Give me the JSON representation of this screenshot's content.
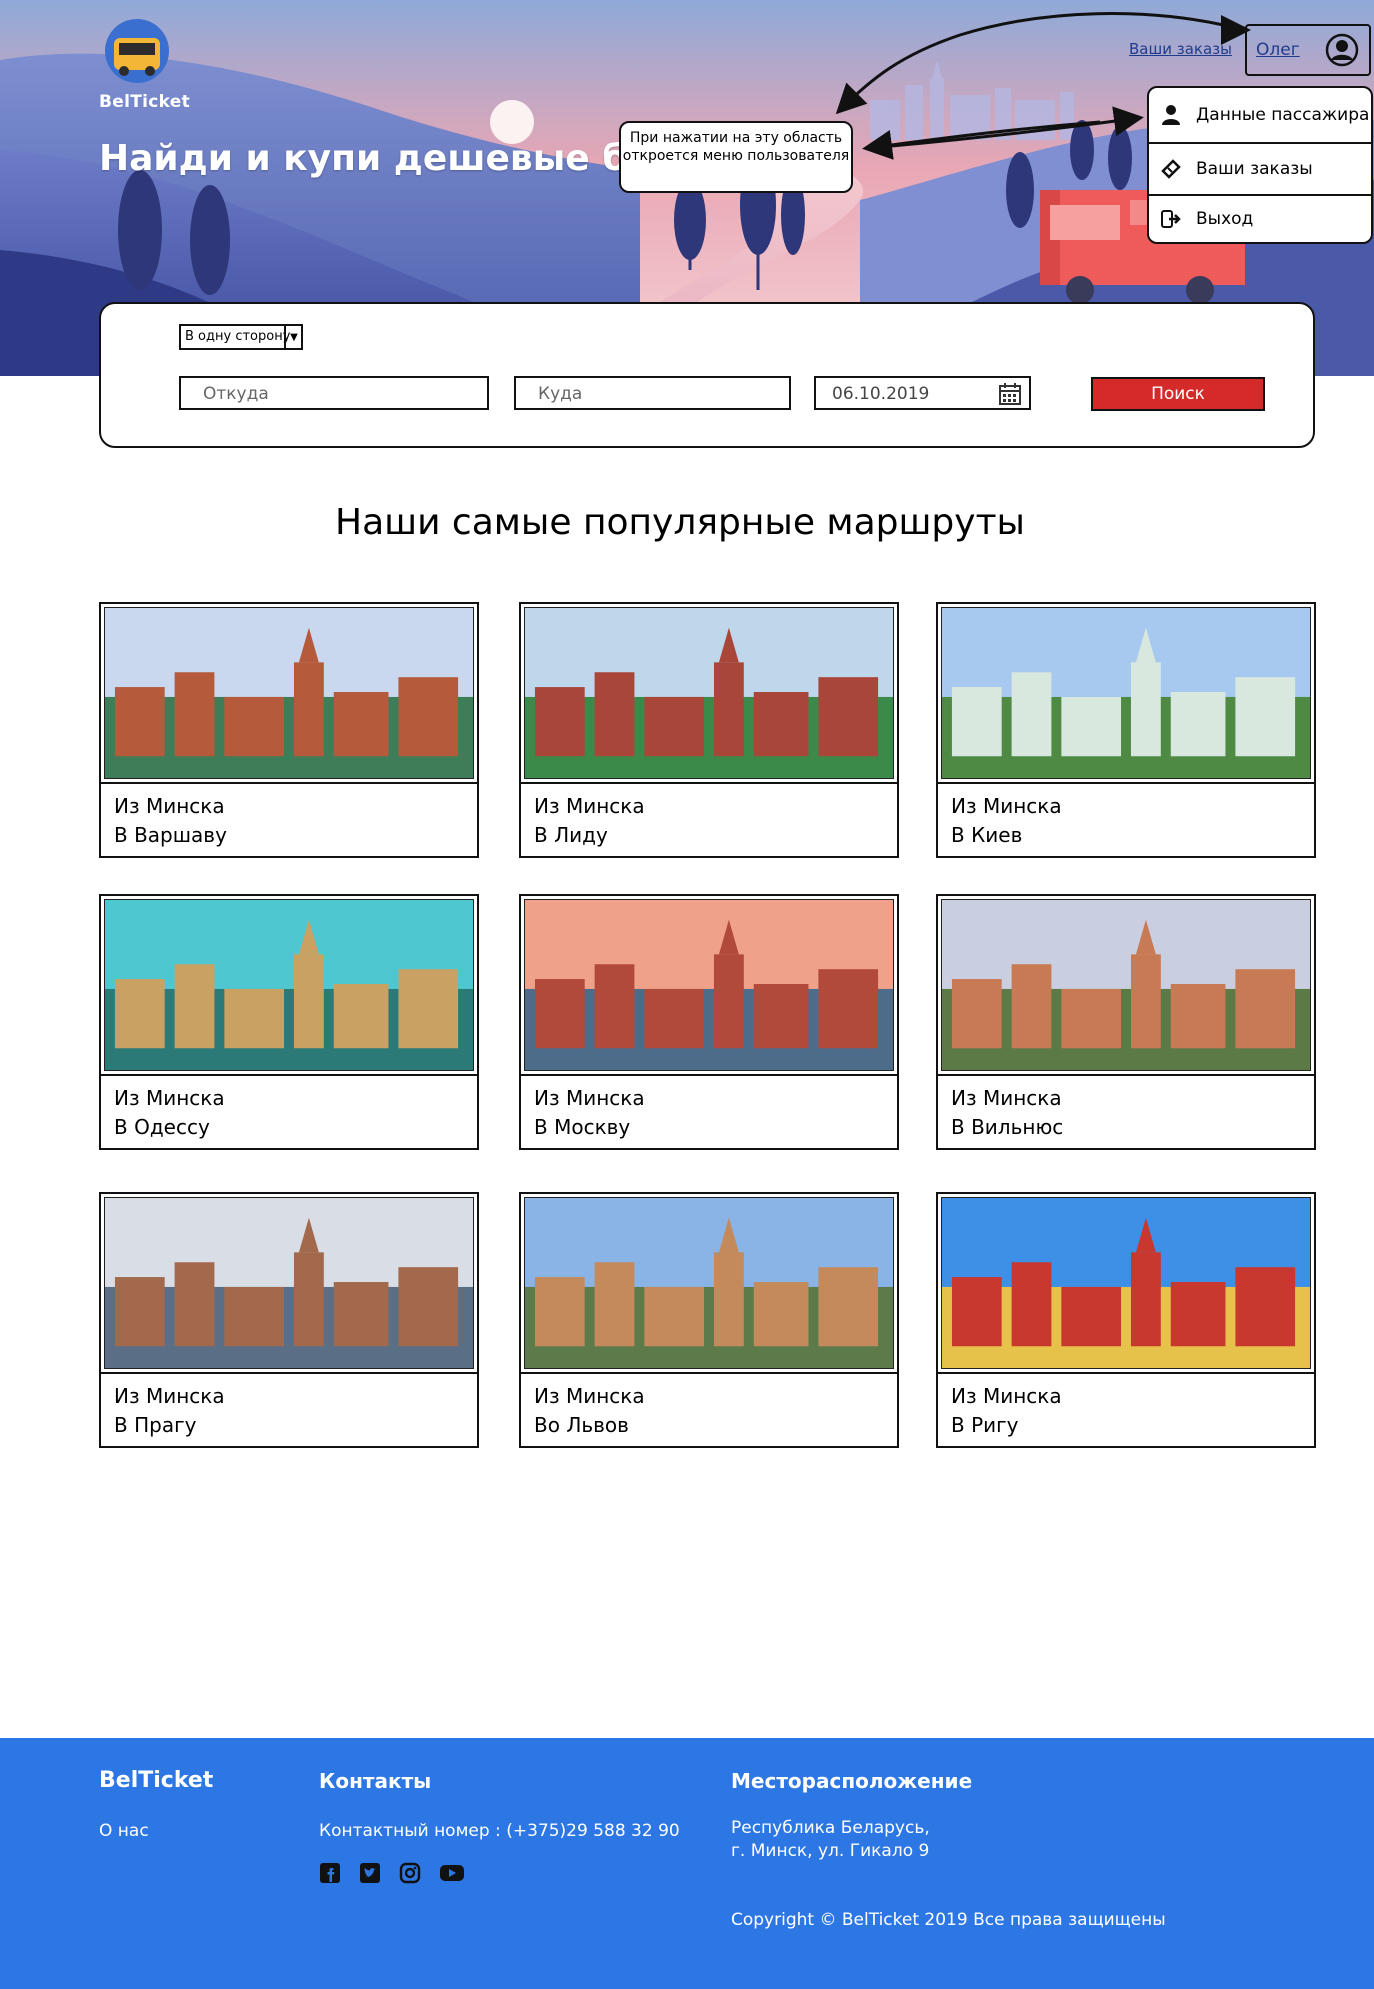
{
  "header": {
    "brand": "BelTicket",
    "title": "Найди и купи дешевые билеты",
    "orders_link": "Ваши заказы",
    "user_name": "Олег"
  },
  "user_menu": {
    "items": [
      {
        "label": "Данные пассажира",
        "icon": "user-icon"
      },
      {
        "label": "Ваши заказы",
        "icon": "ticket-icon"
      },
      {
        "label": "Выход",
        "icon": "logout-icon"
      }
    ]
  },
  "callout": {
    "text": "При нажатии на эту область откроется меню пользователя"
  },
  "search": {
    "trip_type": "В одну сторону",
    "from_placeholder": "Откуда",
    "to_placeholder": "Куда",
    "date": "06.10.2019",
    "button": "Поиск"
  },
  "popular": {
    "title": "Наши самые популярные маршруты",
    "routes": [
      {
        "from": "Из Минска",
        "to": "В Варшаву"
      },
      {
        "from": "Из Минска",
        "to": "В Лиду"
      },
      {
        "from": "Из Минска",
        "to": "В Киев"
      },
      {
        "from": "Из Минска",
        "to": "В Одессу"
      },
      {
        "from": "Из Минска",
        "to": "В Москву"
      },
      {
        "from": "Из Минска",
        "to": "В Вильнюс"
      },
      {
        "from": "Из Минска",
        "to": "В Прагу"
      },
      {
        "from": "Из Минска",
        "to": "Во Львов"
      },
      {
        "from": "Из Минска",
        "to": "В Ригу"
      }
    ]
  },
  "footer": {
    "brand": "BelTicket",
    "about": "О нас",
    "contacts_heading": "Контакты",
    "phone": "Контактный номер : (+375)29 588 32 90",
    "socials": [
      "facebook-icon",
      "twitter-icon",
      "instagram-icon",
      "youtube-icon"
    ],
    "location_heading": "Месторасположение",
    "address_line1": "Республика Беларусь,",
    "address_line2": "г. Минск, ул. Гикало 9",
    "copyright": "Copyright © BelTicket 2019 Все права защищены"
  },
  "colors": {
    "accent_red": "#d42a2a",
    "footer_blue": "#2d77e4",
    "link_blue": "#1f3b8c"
  }
}
